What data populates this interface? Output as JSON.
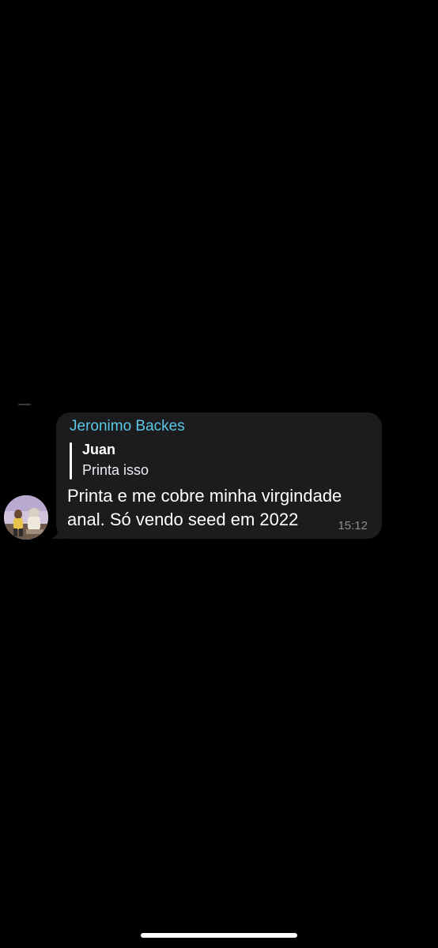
{
  "message": {
    "sender_name": "Jeronimo Backes",
    "reply": {
      "author": "Juan",
      "text": "Printa isso"
    },
    "text_lines": [
      "Printa e me cobre minha virgindade",
      "anal. Só vendo seed em 2022"
    ],
    "timestamp": "15:12"
  },
  "colors": {
    "background": "#000000",
    "bubble": "#1c1c1e",
    "sender_name": "#5ac8e6",
    "text": "#ffffff",
    "timestamp": "#8e8e93"
  },
  "icons": {
    "avatar": "user-avatar-photo"
  }
}
